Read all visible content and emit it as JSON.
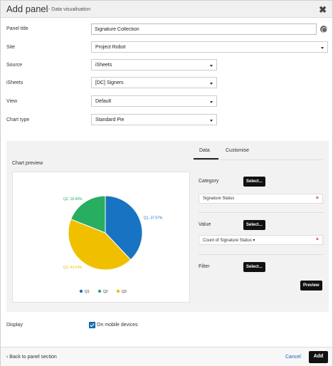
{
  "header": {
    "title": "Add panel",
    "subtitle": "- Data visualisation",
    "close_glyph": "✖"
  },
  "form": {
    "panel_title_label": "Panel title",
    "panel_title_value": "Signature Collection",
    "site_label": "Site",
    "site_value": "Project Robot",
    "source_label": "Source",
    "source_value": "iSheets",
    "isheets_label": "iSheets",
    "isheets_value": "[DC] Signers",
    "view_label": "View",
    "view_value": "Default",
    "chart_type_label": "Chart type",
    "chart_type_value": "Standard Pie"
  },
  "preview": {
    "label": "Chart preview"
  },
  "tabs": {
    "data": "Data",
    "customise": "Customise"
  },
  "data_panel": {
    "category_label": "Category",
    "category_select": "Select...",
    "category_chip": "Signature Status",
    "value_label": "Value",
    "value_select": "Select...",
    "value_chip": "Count of Signature Status ▾",
    "filter_label": "Filter",
    "filter_select": "Select...",
    "preview_button": "Preview",
    "remove_glyph": "×"
  },
  "display": {
    "label": "Display",
    "mobile_label": "On mobile devices"
  },
  "footer": {
    "back": "‹ Back to panel section",
    "cancel": "Cancel",
    "add": "Add"
  },
  "chart_data": {
    "type": "pie",
    "categories": [
      "Q1",
      "Q2",
      "Q3"
    ],
    "values": [
      37.97,
      18.99,
      43.04
    ],
    "slice_labels": [
      "Q1, 37.97%",
      "Q2, 18.99%",
      "Q3, 43.04%"
    ],
    "colors": [
      "#1874c2",
      "#27ae60",
      "#f0c000"
    ],
    "legend_position": "bottom"
  }
}
